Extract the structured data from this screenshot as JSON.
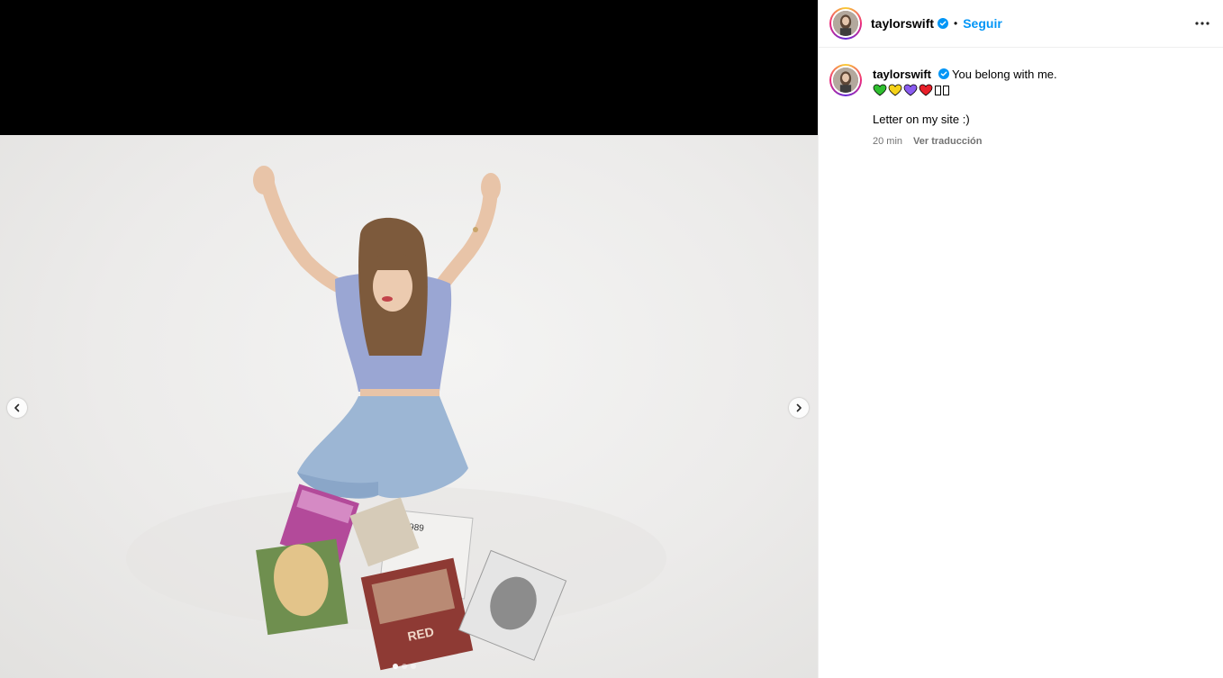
{
  "post": {
    "username": "taylorswift",
    "follow_label": "Seguir",
    "separator": "•",
    "caption_text": "You belong with me.",
    "hearts": [
      {
        "icon": "green-heart-icon",
        "color": "#2fbf2f"
      },
      {
        "icon": "yellow-heart-icon",
        "color": "#f5d21a"
      },
      {
        "icon": "purple-heart-icon",
        "color": "#8a5cf0"
      },
      {
        "icon": "red-heart-icon",
        "color": "#e8202a"
      }
    ],
    "caption_second": "Letter on my site :)",
    "timestamp": "20 min",
    "translate_label": "Ver traducción"
  },
  "colors": {
    "accent": "#0095f6",
    "verified": "#0095f6",
    "muted": "#737373",
    "media_backdrop": "#000000"
  },
  "icons": {
    "more": "more-options-icon",
    "verified": "verified-badge-icon",
    "prev": "chevron-left-icon",
    "next": "chevron-right-icon"
  },
  "carousel": {
    "slide_count": 3,
    "active_slide": 1
  }
}
